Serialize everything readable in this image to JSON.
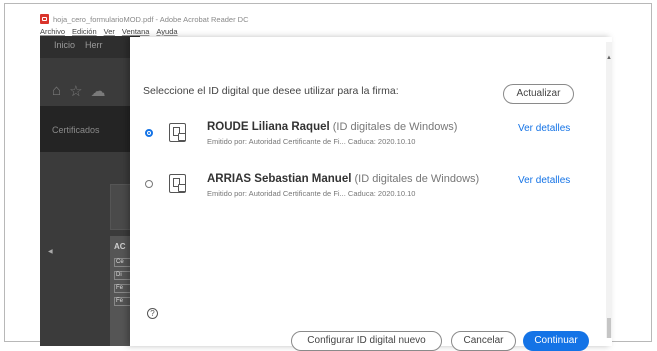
{
  "window": {
    "title": "hoja_cero_formularioMOD.pdf - Adobe Acrobat Reader DC",
    "menu": [
      "Archivo",
      "Edición",
      "Ver",
      "Ventana",
      "Ayuda"
    ]
  },
  "app": {
    "nav": [
      "Inicio",
      "Herr"
    ],
    "side_label": "Certificados",
    "list_label": "AC",
    "list_rows": [
      "Ce",
      "Di",
      "Fe",
      "Fe"
    ]
  },
  "dialog": {
    "prompt": "Seleccione el ID digital que desee utilizar para la firma:",
    "refresh_label": "Actualizar",
    "ids": [
      {
        "name": "ROUDE Liliana Raquel",
        "type": "(ID digitales de Windows)",
        "issuer": "Emitido por: Autoridad Certificante de Fi... Caduca: 2020.10.10",
        "details": "Ver detalles",
        "selected": true
      },
      {
        "name": "ARRIAS Sebastian Manuel",
        "type": "(ID digitales de Windows)",
        "issuer": "Emitido por: Autoridad Certificante de Fi... Caduca: 2020.10.10",
        "details": "Ver detalles",
        "selected": false
      }
    ],
    "help_glyph": "?",
    "configure_label": "Configurar ID digital nuevo",
    "cancel_label": "Cancelar",
    "continue_label": "Continuar"
  },
  "colors": {
    "accent": "#1473e6",
    "app_dark": "#3b3b3b"
  }
}
